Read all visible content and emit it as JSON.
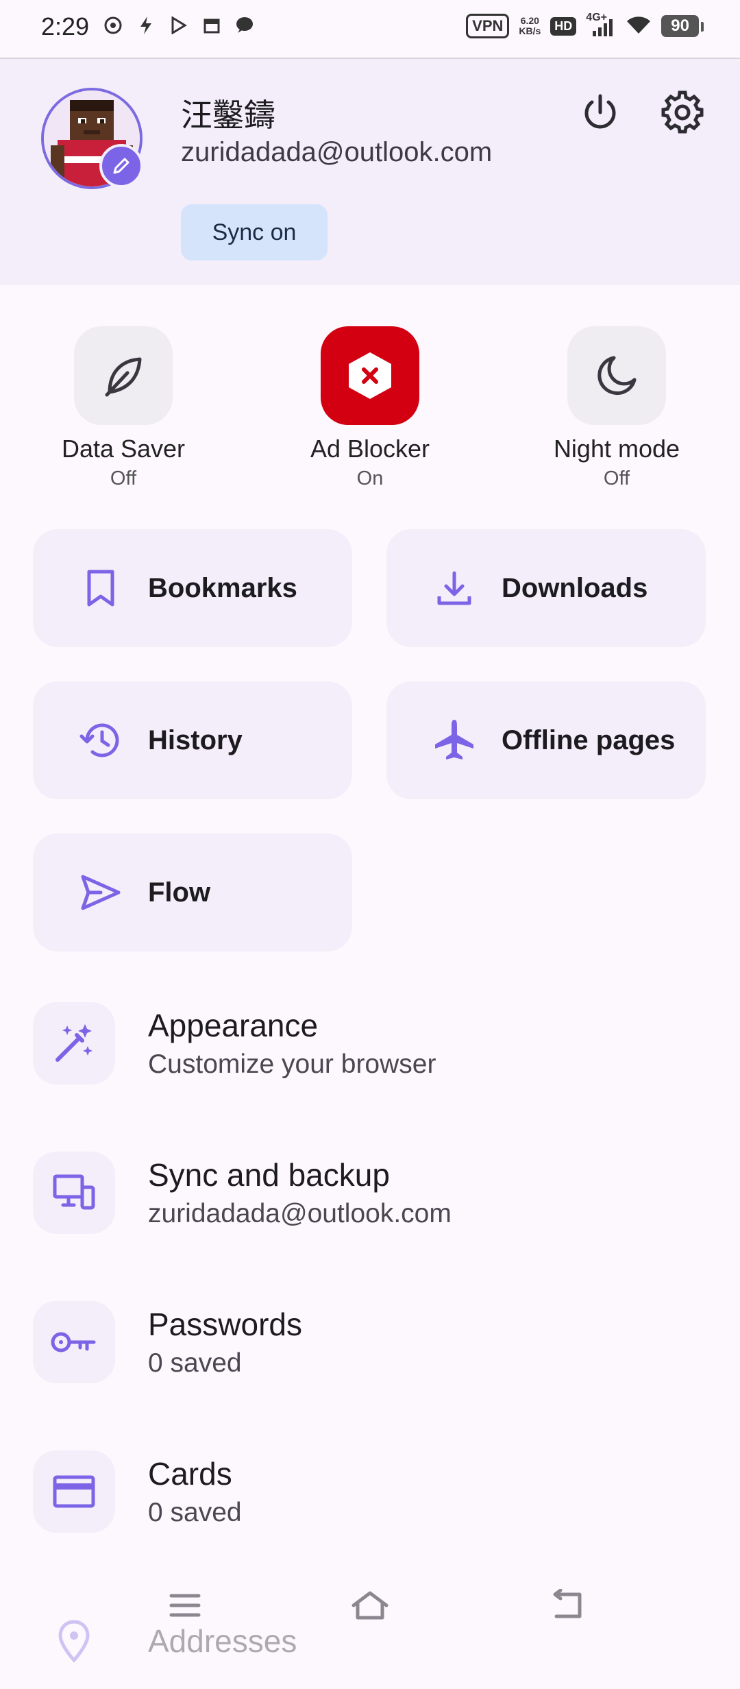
{
  "status_bar": {
    "time": "2:29",
    "vpn": "VPN",
    "speed_value": "6.20",
    "speed_unit": "KB/s",
    "hd": "HD",
    "network": "4G+",
    "battery": "90"
  },
  "account": {
    "name": "汪鑿鑄",
    "email": "zuridadada@outlook.com",
    "sync_label": "Sync on"
  },
  "toggles": [
    {
      "label": "Data Saver",
      "state": "Off",
      "icon": "leaf-icon"
    },
    {
      "label": "Ad Blocker",
      "state": "On",
      "icon": "ad-blocker-icon"
    },
    {
      "label": "Night mode",
      "state": "Off",
      "icon": "moon-icon"
    }
  ],
  "tiles": [
    {
      "label": "Bookmarks",
      "icon": "bookmark-icon"
    },
    {
      "label": "Downloads",
      "icon": "download-icon"
    },
    {
      "label": "History",
      "icon": "history-icon"
    },
    {
      "label": "Offline pages",
      "icon": "airplane-icon"
    },
    {
      "label": "Flow",
      "icon": "send-icon"
    }
  ],
  "settings": [
    {
      "title": "Appearance",
      "subtitle": "Customize your browser",
      "icon": "magic-wand-icon"
    },
    {
      "title": "Sync and backup",
      "subtitle": "zuridadada@outlook.com",
      "icon": "devices-icon"
    },
    {
      "title": "Passwords",
      "subtitle": "0 saved",
      "icon": "key-icon"
    },
    {
      "title": "Cards",
      "subtitle": "0 saved",
      "icon": "credit-card-icon"
    },
    {
      "title": "Addresses",
      "subtitle": "",
      "icon": "location-pin-icon"
    }
  ],
  "colors": {
    "accent": "#7b64e6",
    "header_bg": "#f3eef9",
    "ad_blocker_red": "#d30012",
    "sync_button_bg": "#d6e4fb"
  }
}
